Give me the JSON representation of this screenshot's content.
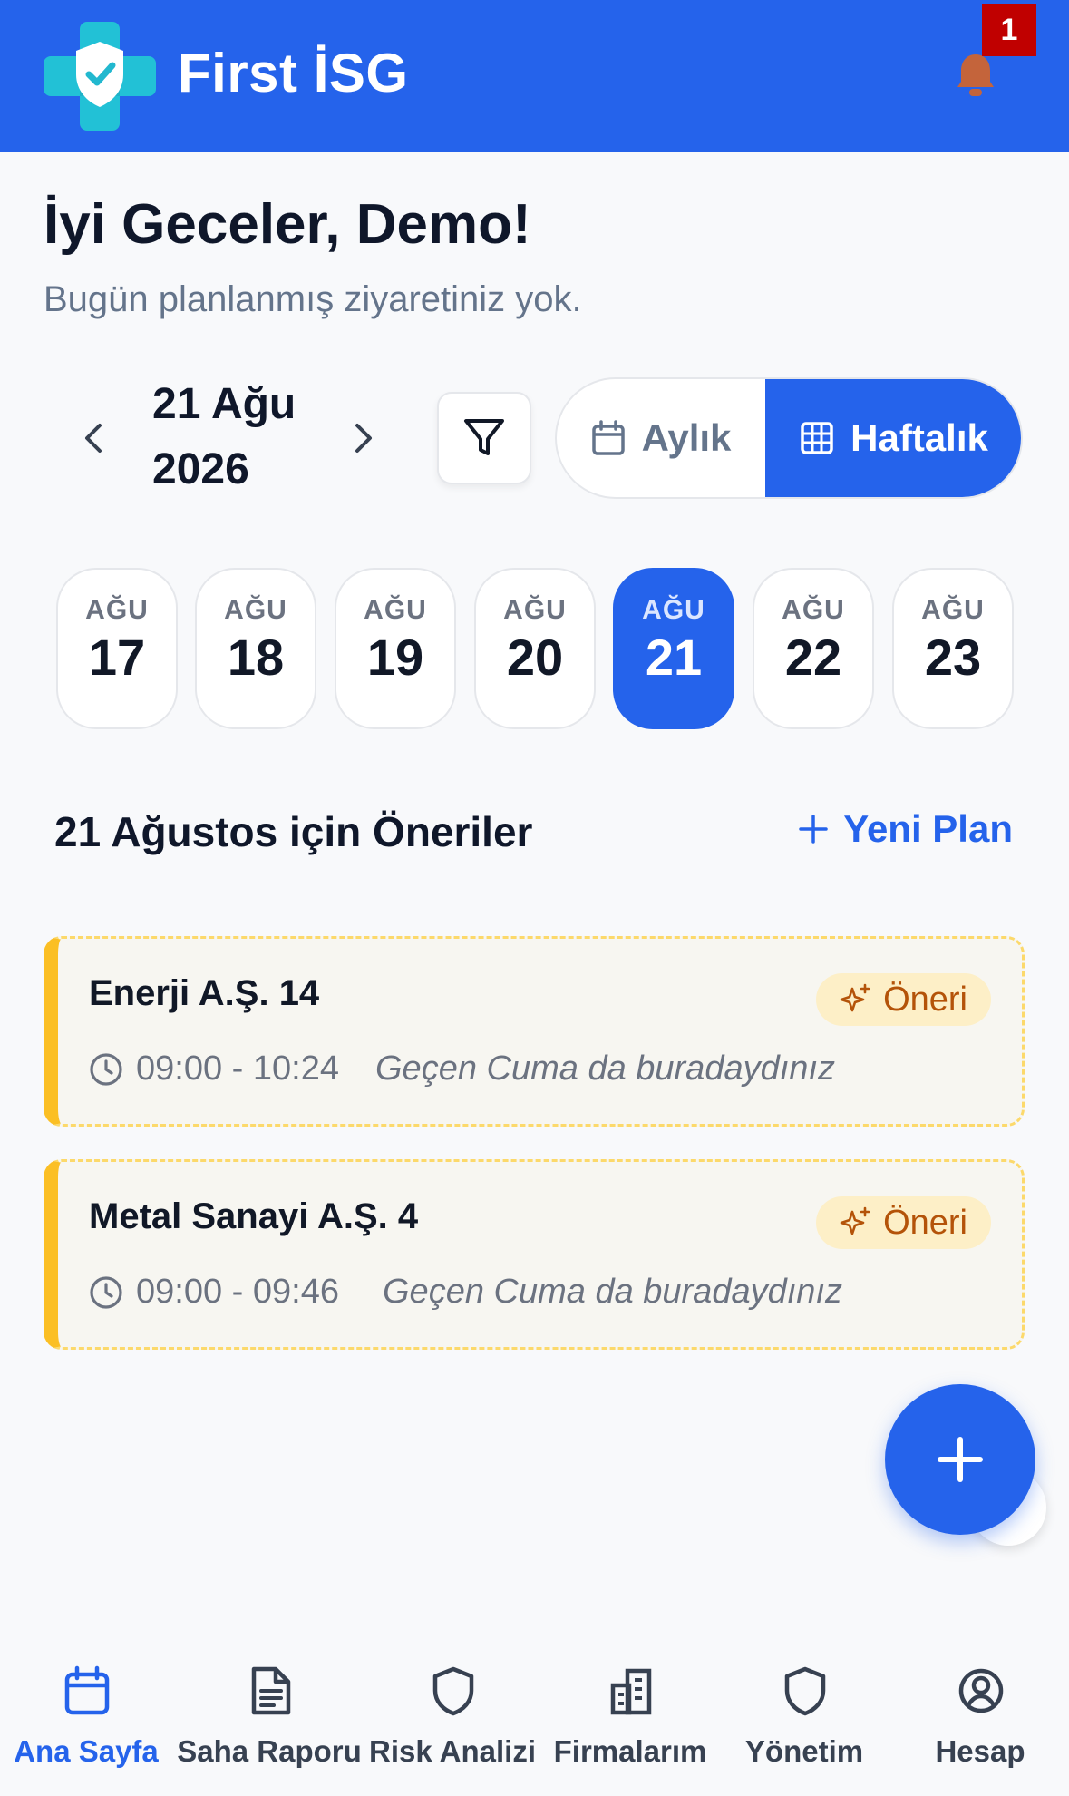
{
  "app": {
    "title": "First İSG",
    "notification_count": "1"
  },
  "greeting": {
    "title": "İyi Geceler, Demo!",
    "subtitle": "Bugün planlanmış ziyaretiniz yok."
  },
  "calendar": {
    "current_date": "21 Ağu 2026",
    "view_monthly": "Aylık",
    "view_weekly": "Haftalık",
    "active_view": "Haftalık",
    "days": [
      {
        "month": "AĞU",
        "day": "17"
      },
      {
        "month": "AĞU",
        "day": "18"
      },
      {
        "month": "AĞU",
        "day": "19"
      },
      {
        "month": "AĞU",
        "day": "20"
      },
      {
        "month": "AĞU",
        "day": "21"
      },
      {
        "month": "AĞU",
        "day": "22"
      },
      {
        "month": "AĞU",
        "day": "23"
      }
    ],
    "selected_day": "21"
  },
  "suggestions": {
    "title": "21 Ağustos için Öneriler",
    "new_plan_label": "Yeni Plan",
    "items": [
      {
        "company": "Enerji A.Ş. 14",
        "badge": "Öneri",
        "time": "09:00 - 10:24",
        "note": "Geçen Cuma da buradaydınız"
      },
      {
        "company": "Metal Sanayi A.Ş. 4",
        "badge": "Öneri",
        "time": "09:00 - 09:46",
        "note": "Geçen Cuma da buradaydınız"
      }
    ]
  },
  "bottom_nav": [
    {
      "label": "Ana Sayfa",
      "icon": "calendar-icon",
      "active": true
    },
    {
      "label": "Saha Raporu",
      "icon": "document-icon",
      "active": false
    },
    {
      "label": "Risk Analizi",
      "icon": "shield-icon",
      "active": false
    },
    {
      "label": "Firmalarım",
      "icon": "building-icon",
      "active": false
    },
    {
      "label": "Yönetim",
      "icon": "shield-icon",
      "active": false
    },
    {
      "label": "Hesap",
      "icon": "user-circle-icon",
      "active": false
    }
  ],
  "colors": {
    "primary": "#2563eb",
    "suggestion_accent": "#fbbf24",
    "badge_bg": "#fdefc7",
    "badge_text": "#b45309",
    "notification_badge": "#c00000"
  }
}
